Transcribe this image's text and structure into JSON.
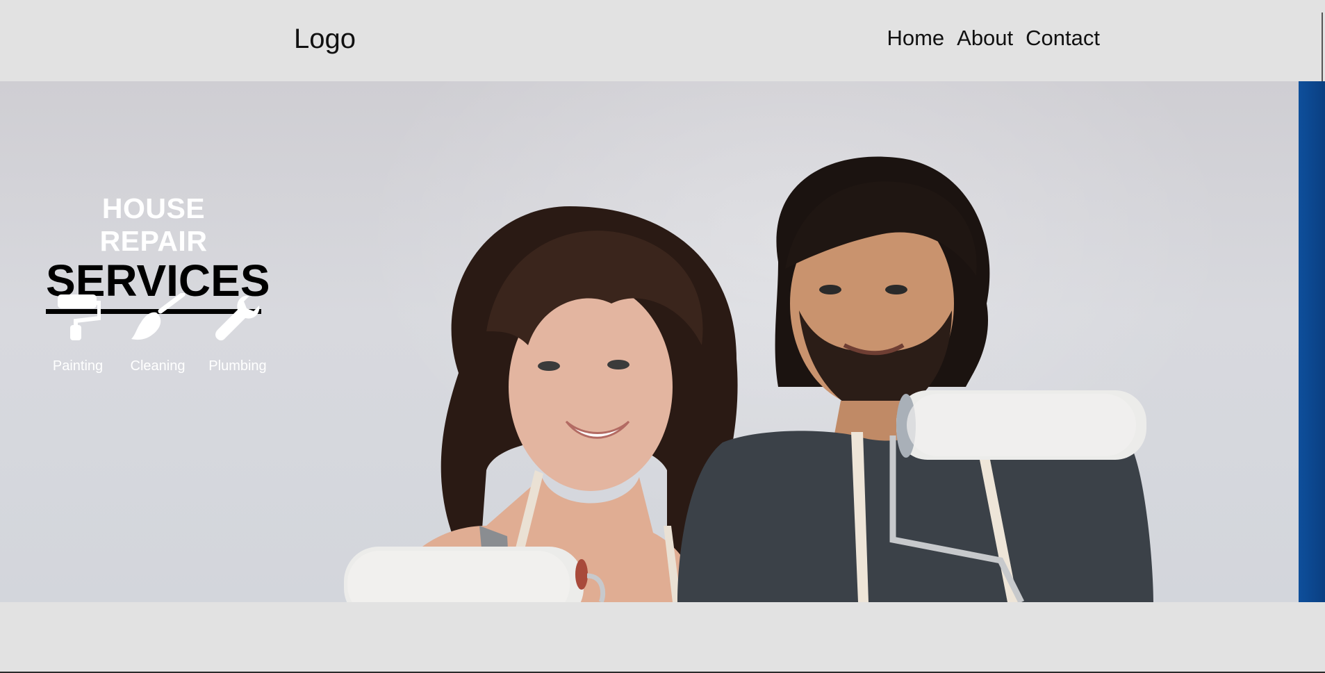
{
  "header": {
    "logo": "Logo",
    "nav": [
      "Home",
      "About",
      "Contact"
    ]
  },
  "hero": {
    "title_line1": "HOUSE REPAIR",
    "title_line2": "SERVICES",
    "services": [
      {
        "label": "Painting",
        "icon": "paint-roller-icon"
      },
      {
        "label": "Cleaning",
        "icon": "brush-icon"
      },
      {
        "label": "Plumbing",
        "icon": "wrench-icon"
      }
    ],
    "image": "two-painters-with-rollers-photo"
  },
  "colors": {
    "header_bg": "#e2e2e2",
    "accent_blue": "#0e4f9b",
    "title_white": "#ffffff",
    "title_black": "#000000"
  }
}
